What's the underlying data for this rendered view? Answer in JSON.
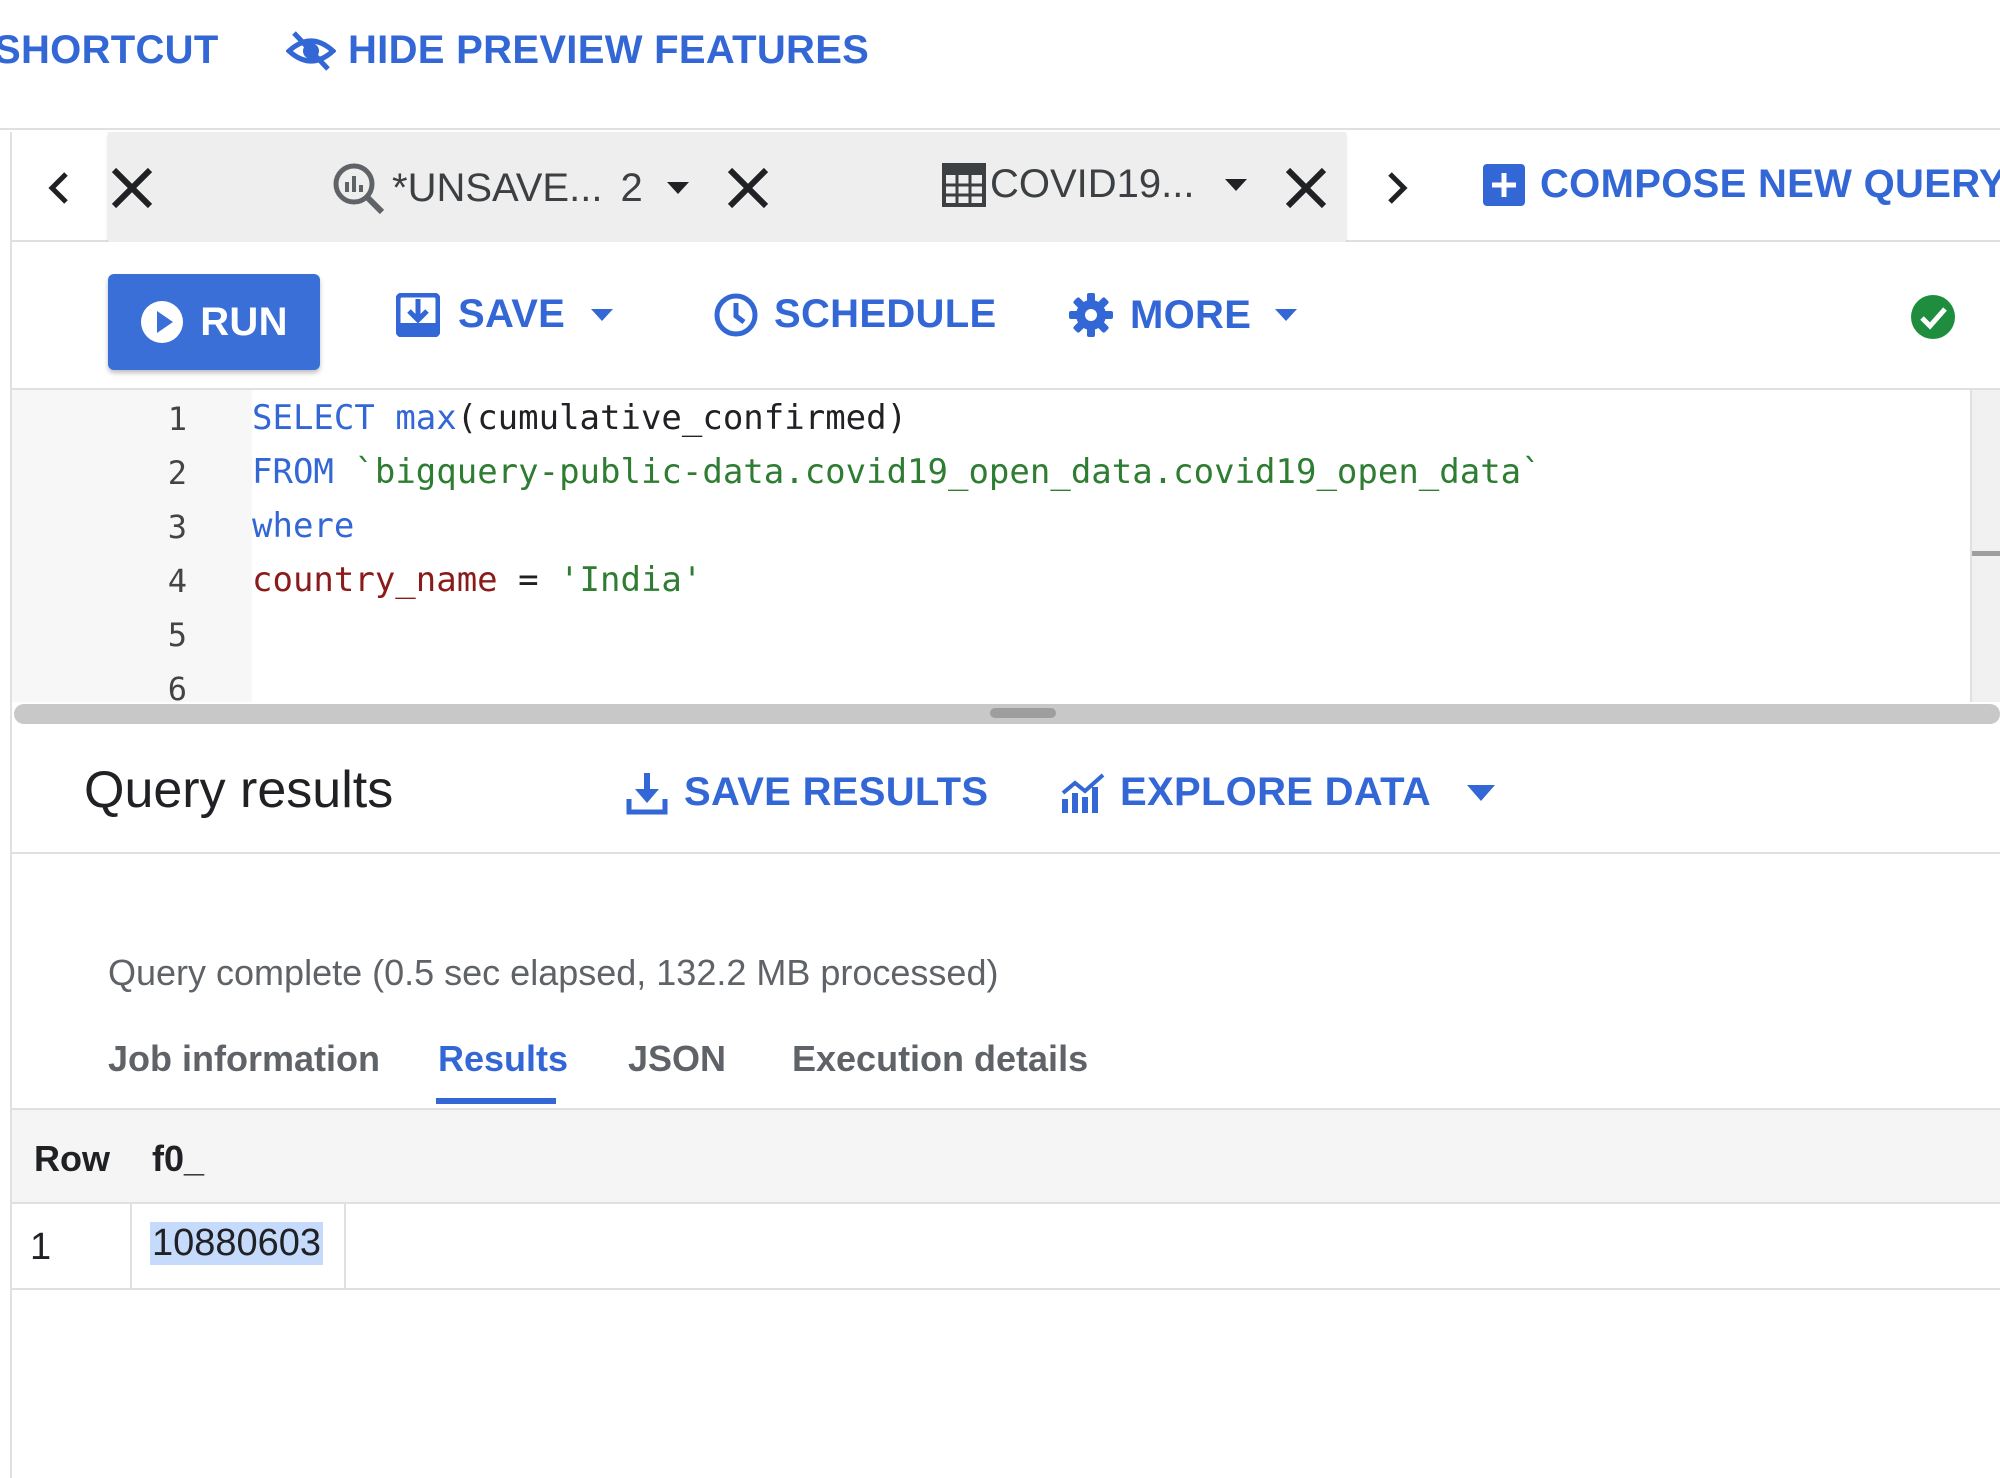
{
  "topbar": {
    "shortcut_label": "SHORTCUT",
    "hide_preview_label": "HIDE PREVIEW FEATURES"
  },
  "tabs": [
    {
      "label": "*UNSAVE...",
      "badge": "2",
      "icon": "query-icon"
    },
    {
      "label": "COVID19...",
      "icon": "table-icon"
    }
  ],
  "compose_label": "COMPOSE NEW QUERY",
  "toolbar": {
    "run_label": "RUN",
    "save_label": "SAVE",
    "schedule_label": "SCHEDULE",
    "more_label": "MORE",
    "status_icon": "check-circle-icon"
  },
  "editor": {
    "line_numbers": [
      "1",
      "2",
      "3",
      "4",
      "5",
      "6"
    ],
    "lines": [
      [
        {
          "t": "SELECT",
          "c": "kw"
        },
        {
          "t": " ",
          "c": ""
        },
        {
          "t": "max",
          "c": "kw"
        },
        {
          "t": "(cumulative_confirmed)",
          "c": ""
        }
      ],
      [
        {
          "t": "FROM",
          "c": "kw"
        },
        {
          "t": " ",
          "c": ""
        },
        {
          "t": "`bigquery-public-data.covid19_open_data.covid19_open_data`",
          "c": "str"
        }
      ],
      [
        {
          "t": "where",
          "c": "kw"
        }
      ],
      [
        {
          "t": "country_name",
          "c": "ident"
        },
        {
          "t": " = ",
          "c": ""
        },
        {
          "t": "'India'",
          "c": "str"
        }
      ],
      [],
      []
    ]
  },
  "results": {
    "title": "Query results",
    "save_results_label": "SAVE RESULTS",
    "explore_data_label": "EXPLORE DATA",
    "status": "Query complete (0.5 sec elapsed, 132.2 MB processed)",
    "tabs": [
      "Job information",
      "Results",
      "JSON",
      "Execution details"
    ],
    "active_tab": "Results",
    "columns": [
      "Row",
      "f0_"
    ],
    "rows": [
      [
        "1",
        "10880603"
      ]
    ]
  },
  "colors": {
    "accent": "#3367d6",
    "run_button": "#3b6fd8",
    "success": "#1e8e3e",
    "selection": "#c6dafc"
  }
}
